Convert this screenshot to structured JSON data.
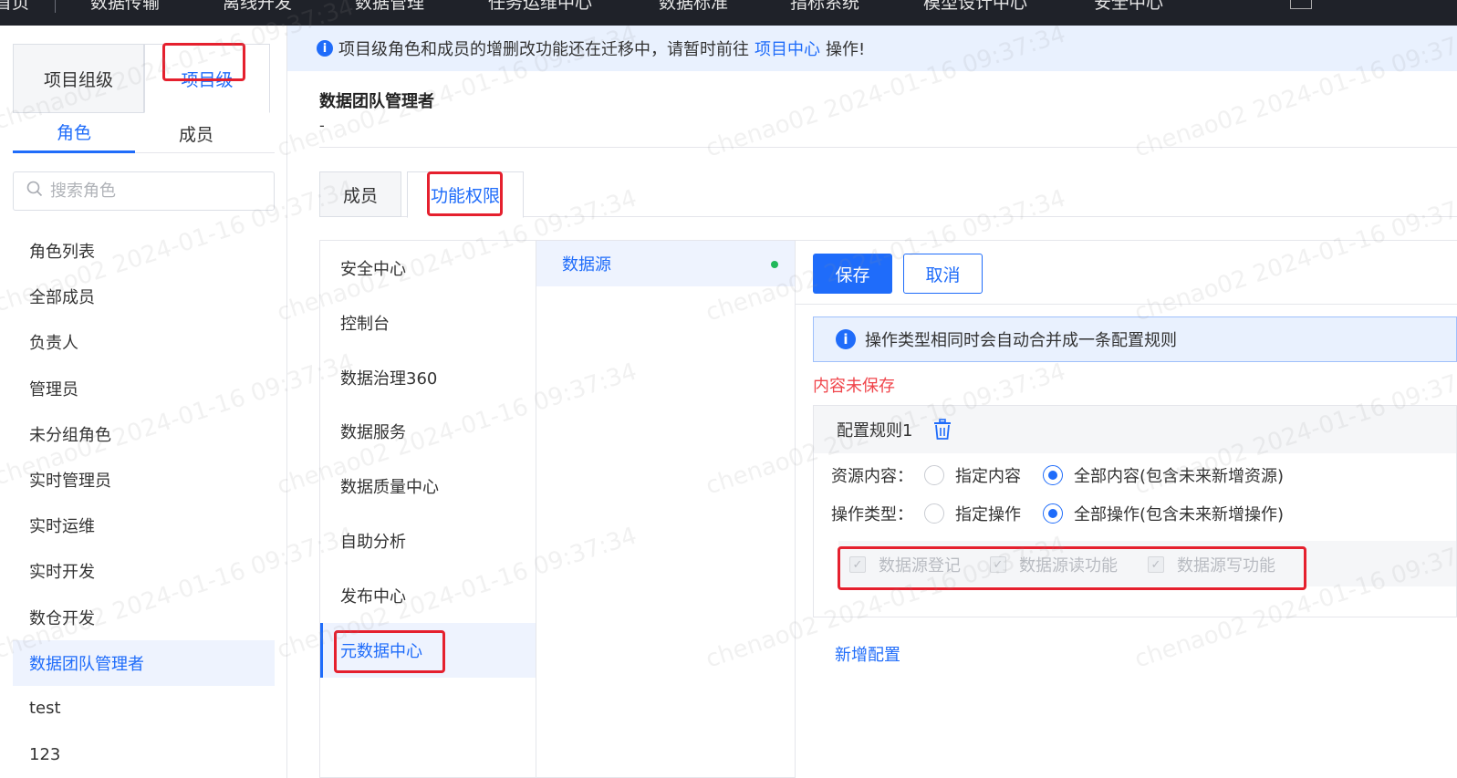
{
  "top_nav": {
    "items": [
      "首页",
      "数据传输",
      "离线开发",
      "数据管理",
      "任务运维中心",
      "数据标准",
      "指标系统",
      "模型设计中心",
      "安全中心",
      "···"
    ]
  },
  "sidebar": {
    "level_tabs": {
      "group": "项目组级",
      "project": "项目级"
    },
    "sub_tabs": {
      "role": "角色",
      "member": "成员"
    },
    "search_placeholder": "搜索角色",
    "roles": [
      "角色列表",
      "全部成员",
      "负责人",
      "管理员",
      "未分组角色",
      "实时管理员",
      "实时运维",
      "实时开发",
      "数仓开发",
      "数据团队管理者",
      "test",
      "123"
    ],
    "active_role": "数据团队管理者"
  },
  "banner": {
    "prefix": "项目级角色和成员的增删改功能还在迁移中，请暂时前往",
    "link": "项目中心",
    "suffix": "操作!"
  },
  "role_header": {
    "title": "数据团队管理者",
    "description": "-"
  },
  "detail_tabs": {
    "members": "成员",
    "permissions": "功能权限"
  },
  "modules": [
    "安全中心",
    "控制台",
    "数据治理360",
    "数据服务",
    "数据质量中心",
    "自助分析",
    "发布中心",
    "元数据中心"
  ],
  "active_module": "元数据中心",
  "resources": [
    "数据源"
  ],
  "config": {
    "save_label": "保存",
    "cancel_label": "取消",
    "tip": "操作类型相同时会自动合并成一条配置规则",
    "unsaved": "内容未保存",
    "rule_title": "配置规则1",
    "resource_label": "资源内容：",
    "resource_options": [
      "指定内容",
      "全部内容(包含未来新增资源)"
    ],
    "resource_selected": 1,
    "operation_label": "操作类型：",
    "operation_options": [
      "指定操作",
      "全部操作(包含未来新增操作)"
    ],
    "operation_selected": 1,
    "permissions": [
      "数据源登记",
      "数据源读功能",
      "数据源写功能"
    ],
    "add_label": "新增配置"
  },
  "colors": {
    "primary": "#1f6cfa",
    "highlight": "#e5202e",
    "warning": "#f0454b",
    "success": "#20b85a"
  },
  "watermark": "chenao02 2024-01-16 09:37:34"
}
